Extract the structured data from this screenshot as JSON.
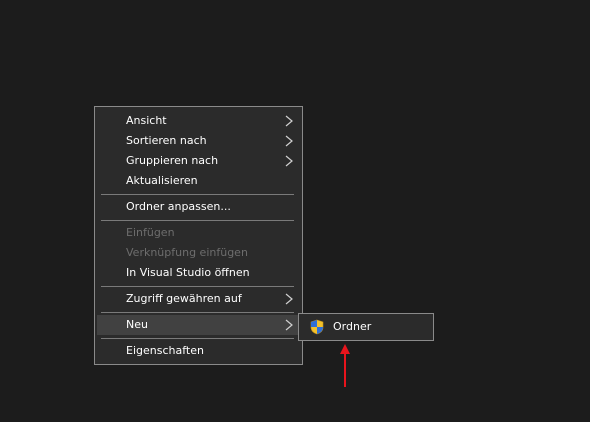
{
  "context_menu": {
    "items": [
      {
        "label": "Ansicht",
        "has_submenu": true,
        "enabled": true
      },
      {
        "label": "Sortieren nach",
        "has_submenu": true,
        "enabled": true
      },
      {
        "label": "Gruppieren nach",
        "has_submenu": true,
        "enabled": true
      },
      {
        "label": "Aktualisieren",
        "has_submenu": false,
        "enabled": true
      },
      {
        "label": "Ordner anpassen...",
        "has_submenu": false,
        "enabled": true
      },
      {
        "label": "Einfügen",
        "has_submenu": false,
        "enabled": false
      },
      {
        "label": "Verknüpfung einfügen",
        "has_submenu": false,
        "enabled": false
      },
      {
        "label": "In Visual Studio öffnen",
        "has_submenu": false,
        "enabled": true
      },
      {
        "label": "Zugriff gewähren auf",
        "has_submenu": true,
        "enabled": true
      },
      {
        "label": "Neu",
        "has_submenu": true,
        "enabled": true,
        "highlighted": true
      },
      {
        "label": "Eigenschaften",
        "has_submenu": false,
        "enabled": true
      }
    ]
  },
  "submenu": {
    "items": [
      {
        "label": "Ordner",
        "icon": "folder-shield-icon"
      }
    ]
  },
  "annotation": {
    "arrow_color": "#e8141c"
  },
  "colors": {
    "background": "#1c1c1c",
    "menu_background": "#2b2b2b",
    "menu_border": "#8a8a8a",
    "highlight": "#414141",
    "text": "#ffffff",
    "disabled_text": "#6d6d6d"
  }
}
